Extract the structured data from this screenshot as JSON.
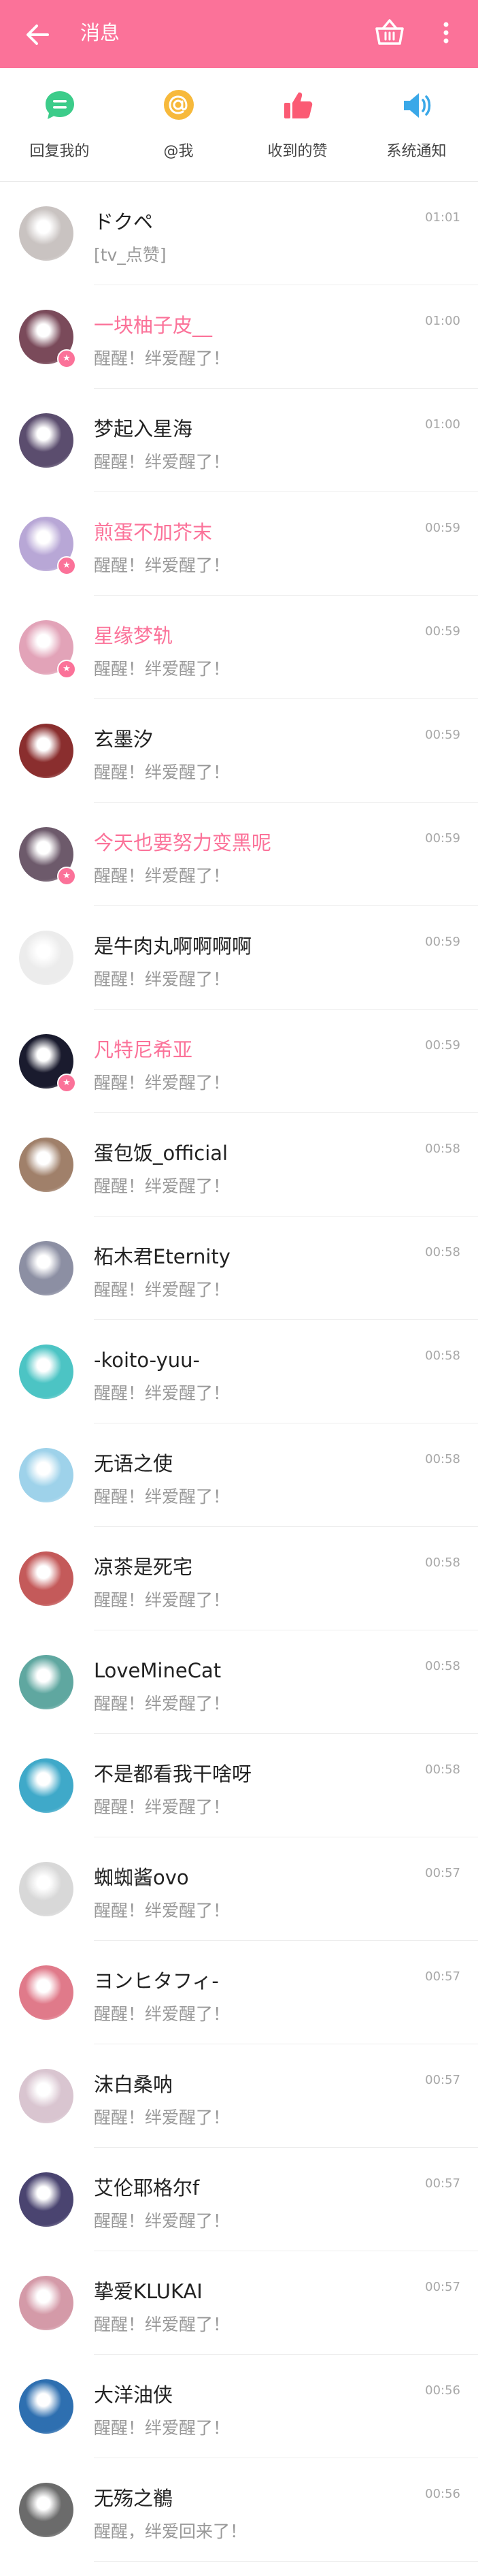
{
  "header": {
    "title": "消息"
  },
  "tabs": [
    {
      "label": "回复我的",
      "icon": "reply-icon",
      "color": "#3ccc8a"
    },
    {
      "label": "@我",
      "icon": "at-icon",
      "color": "#f7b93b"
    },
    {
      "label": "收到的赞",
      "icon": "thumb-up-icon",
      "color": "#fb5b74"
    },
    {
      "label": "系统通知",
      "icon": "speaker-icon",
      "color": "#3aa8e8"
    }
  ],
  "colors": {
    "brand": "#fb7299",
    "vip_name": "#fb7299"
  },
  "messages": [
    {
      "name": "ドクペ",
      "text": "[tv_点赞]",
      "time": "01:01",
      "vip": false,
      "badge": false,
      "avatar_color": "#c9c3c1"
    },
    {
      "name": "一块柚子皮__",
      "text": "醒醒！绊爱醒了！",
      "time": "01:00",
      "vip": true,
      "badge": true,
      "avatar_color": "#7a4a5a"
    },
    {
      "name": "梦起入星海",
      "text": "醒醒！绊爱醒了！",
      "time": "01:00",
      "vip": false,
      "badge": false,
      "avatar_color": "#5b4d6e"
    },
    {
      "name": "煎蛋不加芥末",
      "text": "醒醒！绊爱醒了！",
      "time": "00:59",
      "vip": true,
      "badge": true,
      "avatar_color": "#b8a7d6"
    },
    {
      "name": "星缘梦轨",
      "text": "醒醒！绊爱醒了！",
      "time": "00:59",
      "vip": true,
      "badge": true,
      "avatar_color": "#e2a3b8"
    },
    {
      "name": "玄墨汐",
      "text": "醒醒！绊爱醒了！",
      "time": "00:59",
      "vip": false,
      "badge": false,
      "avatar_color": "#8a2e2e"
    },
    {
      "name": "今天也要努力变黑呢",
      "text": "醒醒！绊爱醒了！",
      "time": "00:59",
      "vip": true,
      "badge": true,
      "avatar_color": "#6d5a6b"
    },
    {
      "name": "是牛肉丸啊啊啊啊",
      "text": "醒醒！绊爱醒了！",
      "time": "00:59",
      "vip": false,
      "badge": false,
      "avatar_color": "#ececec"
    },
    {
      "name": "凡特尼希亚",
      "text": "醒醒！绊爱醒了！",
      "time": "00:59",
      "vip": true,
      "badge": true,
      "avatar_color": "#1a1b2e"
    },
    {
      "name": "蛋包饭_official",
      "text": "醒醒！绊爱醒了！",
      "time": "00:58",
      "vip": false,
      "badge": false,
      "avatar_color": "#a0806a"
    },
    {
      "name": "柘木君Eternity",
      "text": "醒醒！绊爱醒了！",
      "time": "00:58",
      "vip": false,
      "badge": false,
      "avatar_color": "#8c8fa3"
    },
    {
      "name": "-koito-yuu-",
      "text": "醒醒！绊爱醒了！",
      "time": "00:58",
      "vip": false,
      "badge": false,
      "avatar_color": "#4cc4c4"
    },
    {
      "name": "无语之使",
      "text": "醒醒！绊爱醒了！",
      "time": "00:58",
      "vip": false,
      "badge": false,
      "avatar_color": "#9ed2ea"
    },
    {
      "name": "凉茶是死宅",
      "text": "醒醒！绊爱醒了！",
      "time": "00:58",
      "vip": false,
      "badge": false,
      "avatar_color": "#c45a5a"
    },
    {
      "name": "LoveMineCat",
      "text": "醒醒！绊爱醒了！",
      "time": "00:58",
      "vip": false,
      "badge": false,
      "avatar_color": "#5fa7a0"
    },
    {
      "name": "不是都看我干啥呀",
      "text": "醒醒！绊爱醒了！",
      "time": "00:58",
      "vip": false,
      "badge": false,
      "avatar_color": "#3fa9c9"
    },
    {
      "name": "蜘蜘酱ovo",
      "text": "醒醒！绊爱醒了！",
      "time": "00:57",
      "vip": false,
      "badge": false,
      "avatar_color": "#d8d8d8"
    },
    {
      "name": "ヨンヒタフィ-",
      "text": "醒醒！绊爱醒了！",
      "time": "00:57",
      "vip": false,
      "badge": false,
      "avatar_color": "#e07a8a"
    },
    {
      "name": "沫白桑呐",
      "text": "醒醒！绊爱醒了！",
      "time": "00:57",
      "vip": false,
      "badge": false,
      "avatar_color": "#d9c5d0"
    },
    {
      "name": "艾伦耶格尔f",
      "text": "醒醒！绊爱醒了！",
      "time": "00:57",
      "vip": false,
      "badge": false,
      "avatar_color": "#4a4470"
    },
    {
      "name": "挚爱KLUKAI",
      "text": "醒醒！绊爱醒了！",
      "time": "00:57",
      "vip": false,
      "badge": false,
      "avatar_color": "#d49aa8"
    },
    {
      "name": "大洋油侠",
      "text": "醒醒！绊爱醒了！",
      "time": "00:56",
      "vip": false,
      "badge": false,
      "avatar_color": "#2e6fb0"
    },
    {
      "name": "无殇之鶺",
      "text": "醒醒，绊爱回来了！",
      "time": "00:56",
      "vip": false,
      "badge": false,
      "avatar_color": "#6b6b6b"
    }
  ]
}
